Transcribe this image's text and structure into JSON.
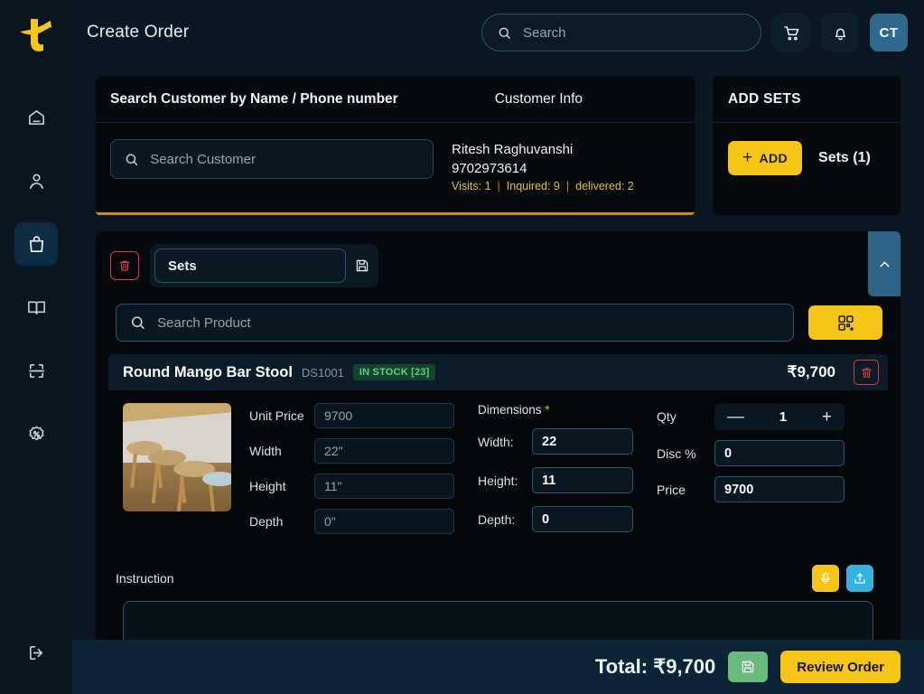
{
  "app": {
    "logo_label": "brand-logo",
    "page_title": "Create Order"
  },
  "header": {
    "search_placeholder": "Search",
    "search_value": "",
    "cart_icon": "cart-icon",
    "bell_icon": "bell-icon",
    "avatar_initials": "CT"
  },
  "sidebar": {
    "items": [
      {
        "icon": "home-icon",
        "label": "Home",
        "active": false
      },
      {
        "icon": "person-icon",
        "label": "Customers",
        "active": false
      },
      {
        "icon": "shopping-bag-icon",
        "label": "Orders",
        "active": true
      },
      {
        "icon": "book-icon",
        "label": "Catalogue",
        "active": false
      },
      {
        "icon": "scan-icon",
        "label": "Scan",
        "active": false
      },
      {
        "icon": "discount-icon",
        "label": "Offers",
        "active": false
      }
    ],
    "logout_icon": "logout-icon"
  },
  "customer": {
    "panel_title": "Search Customer by Name / Phone number",
    "info_title": "Customer Info",
    "search_placeholder": "Search Customer",
    "search_value": "",
    "name": "Ritesh Raghuvanshi",
    "phone": "9702973614",
    "stats": {
      "visits": "Visits: 1",
      "inquired": "Inquired: 9",
      "delivered": "delivered: 2"
    },
    "accent_color": "#d38b15"
  },
  "sets_panel": {
    "title": "ADD SETS",
    "add_label": "ADD",
    "add_plus": "+",
    "count_label": "Sets (1)"
  },
  "set_row": {
    "delete_icon": "trash-icon",
    "name_value": "Sets",
    "save_icon": "save-floppy-icon",
    "collapse_icon": "chevron-up-icon"
  },
  "product_search": {
    "placeholder": "Search Product",
    "value": "",
    "qr_icon": "qr-scan-icon"
  },
  "product": {
    "title": "Round Mango Bar Stool",
    "sku": "DS1001",
    "stock_badge": "IN STOCK [23]",
    "price": "₹9,700",
    "delete_icon": "trash-icon",
    "thumbnail_alt": "bar-stools-photo",
    "readonly_fields": [
      {
        "label": "Unit Price",
        "value": "9700"
      },
      {
        "label": "Width",
        "value": "22\""
      },
      {
        "label": "Height",
        "value": "11\""
      },
      {
        "label": "Depth",
        "value": "0\""
      }
    ],
    "dimensions": {
      "title": "Dimensions",
      "required_mark": "*",
      "fields": [
        {
          "label": "Width:",
          "value": "22"
        },
        {
          "label": "Height:",
          "value": "11"
        },
        {
          "label": "Depth:",
          "value": "0"
        }
      ]
    },
    "qty": {
      "label": "Qty",
      "value": "1",
      "minus": "—",
      "plus": "+"
    },
    "disc": {
      "label": "Disc %",
      "value": "0"
    },
    "price_field": {
      "label": "Price",
      "value": "9700"
    },
    "instruction": {
      "label": "Instruction",
      "value": "",
      "mic_icon": "microphone-icon",
      "upload_icon": "upload-icon"
    }
  },
  "bottom_bar": {
    "total_label": "Total: ₹9,700",
    "save_icon": "save-floppy-icon",
    "review_label": "Review Order"
  },
  "colors": {
    "accent_yellow": "#f5c518",
    "page_bg": "#0a1722",
    "card_bg": "#05080c",
    "bottom_bar_bg": "#0b2436",
    "danger_red": "#d93d3d",
    "stock_green": "#4fd88a",
    "blue_tab": "#2e6388"
  }
}
